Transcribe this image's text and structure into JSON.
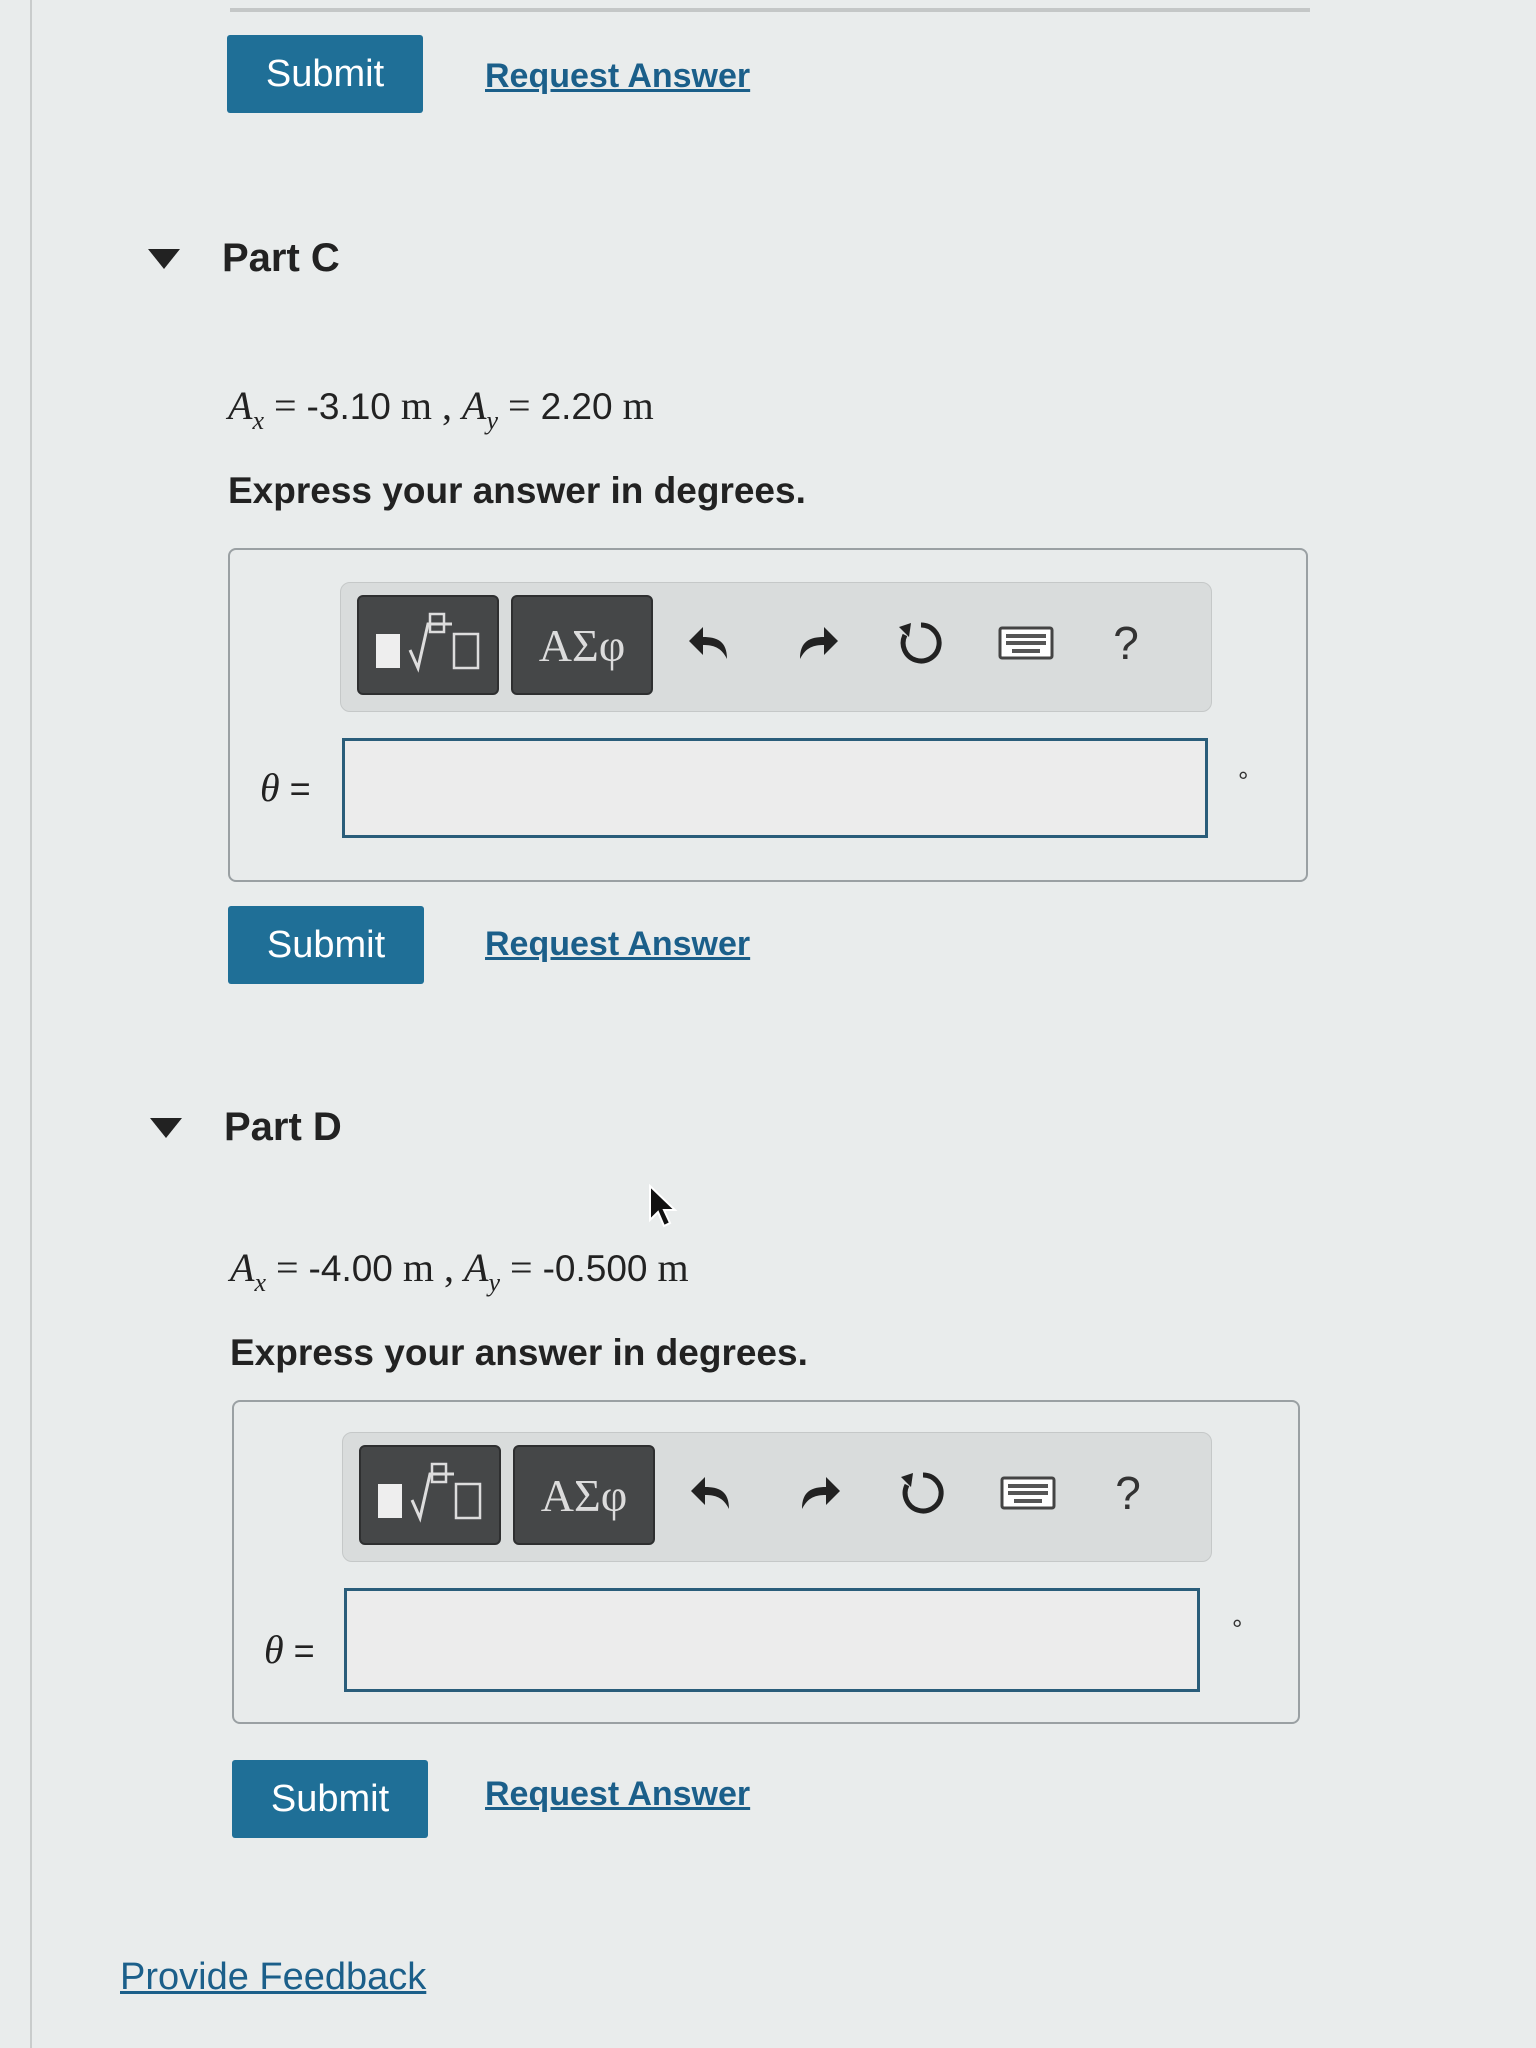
{
  "top": {
    "submit_label": "Submit",
    "request_answer_label": "Request Answer"
  },
  "parts": [
    {
      "title": "Part C",
      "given": {
        "ax_symbol": "A",
        "ax_sub": "x",
        "ax_value": "-3.10",
        "ay_symbol": "A",
        "ay_sub": "y",
        "ay_value": "2.20",
        "unit": "m"
      },
      "instruction": "Express your answer in degrees.",
      "toolbar": {
        "greek_label": "ΑΣφ",
        "help_label": "?"
      },
      "answer_label": "θ",
      "equals": "=",
      "answer_value": "",
      "unit_symbol": "°",
      "submit_label": "Submit",
      "request_answer_label": "Request Answer"
    },
    {
      "title": "Part D",
      "given": {
        "ax_symbol": "A",
        "ax_sub": "x",
        "ax_value": "-4.00",
        "ay_symbol": "A",
        "ay_sub": "y",
        "ay_value": "-0.500",
        "unit": "m"
      },
      "instruction": "Express your answer in degrees.",
      "toolbar": {
        "greek_label": "ΑΣφ",
        "help_label": "?"
      },
      "answer_label": "θ",
      "equals": "=",
      "answer_value": "",
      "unit_symbol": "°",
      "submit_label": "Submit",
      "request_answer_label": "Request Answer"
    }
  ],
  "footer": {
    "feedback_label": "Provide Feedback"
  },
  "icons": {
    "template": "template-icon",
    "undo": "undo-icon",
    "redo": "redo-icon",
    "reset": "reset-icon",
    "keyboard": "keyboard-icon",
    "help": "help-icon",
    "caret": "caret-down-icon"
  },
  "colors": {
    "submit_bg": "#1f6f97",
    "link": "#1b5f8a",
    "input_border": "#2a5d7a",
    "toolbar_btn": "#454748"
  }
}
